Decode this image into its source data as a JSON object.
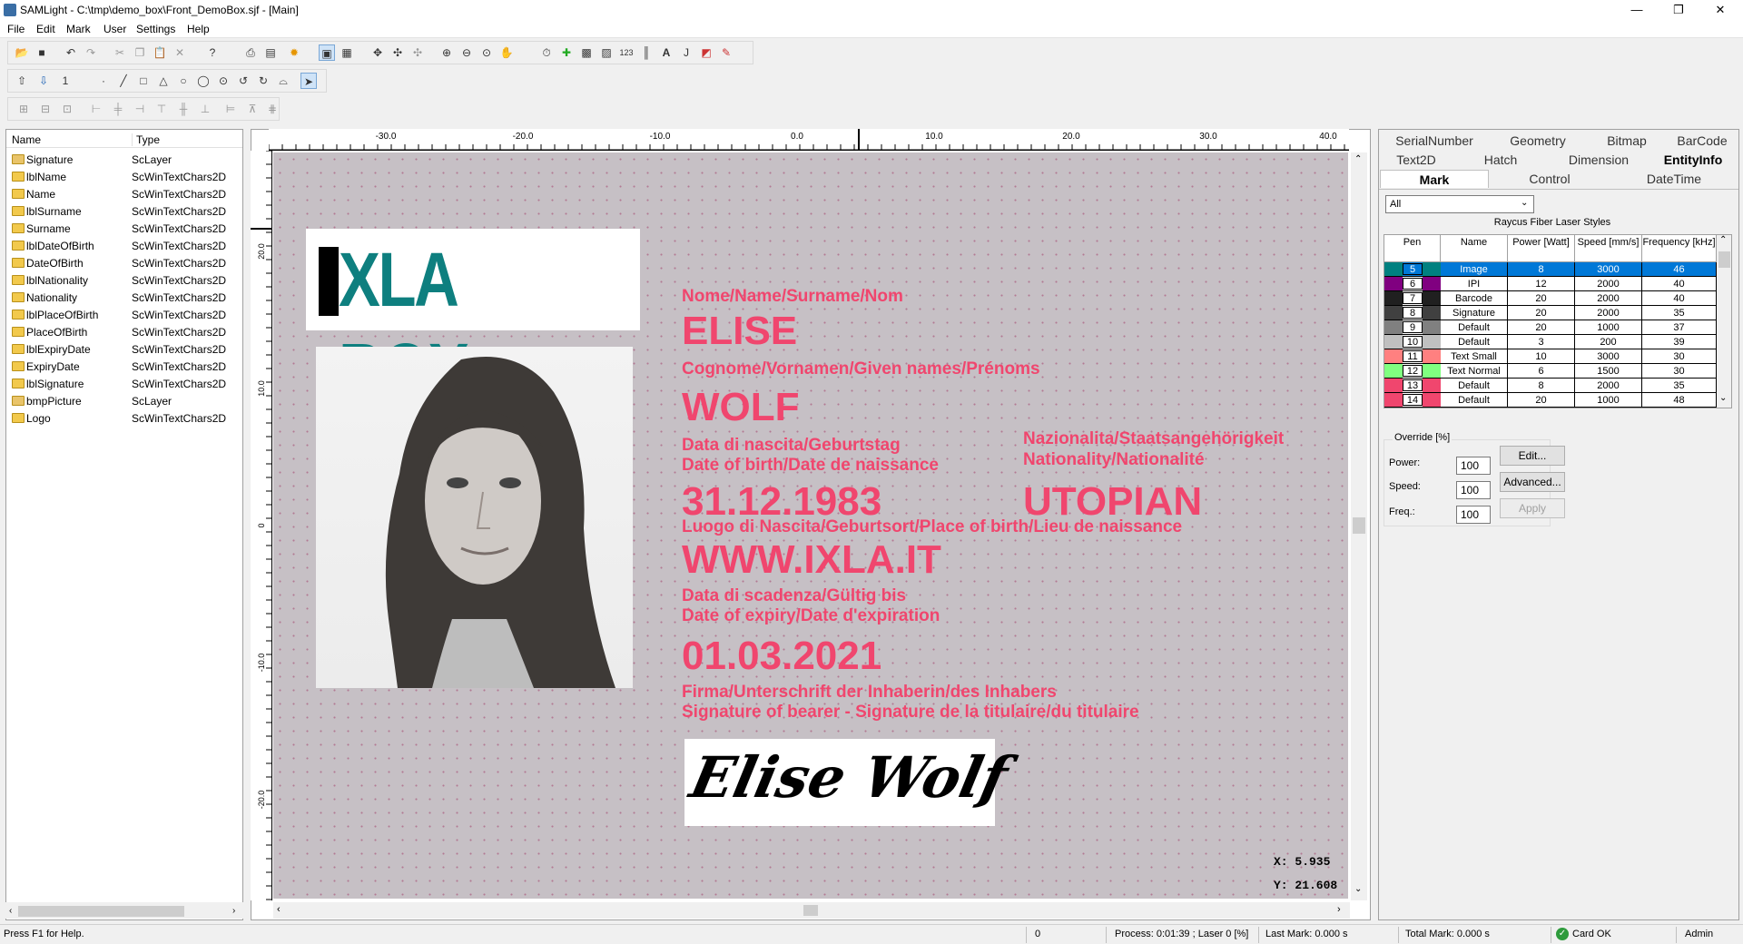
{
  "window": {
    "title": "SAMLight - C:\\tmp\\demo_box\\Front_DemoBox.sjf - [Main]",
    "minimize": "—",
    "maximize": "❐",
    "close": "✕"
  },
  "menu": [
    "File",
    "Edit",
    "Mark",
    "User",
    "Settings",
    "Help"
  ],
  "toolbar2_counter": "1",
  "tree": {
    "col_name": "Name",
    "col_type": "Type",
    "items": [
      {
        "name": "Signature",
        "type": "ScLayer",
        "kind": "layer"
      },
      {
        "name": "lblName",
        "type": "ScWinTextChars2D",
        "kind": "folder"
      },
      {
        "name": "Name",
        "type": "ScWinTextChars2D",
        "kind": "folder"
      },
      {
        "name": "lblSurname",
        "type": "ScWinTextChars2D",
        "kind": "folder"
      },
      {
        "name": "Surname",
        "type": "ScWinTextChars2D",
        "kind": "folder"
      },
      {
        "name": "lblDateOfBirth",
        "type": "ScWinTextChars2D",
        "kind": "folder"
      },
      {
        "name": "DateOfBirth",
        "type": "ScWinTextChars2D",
        "kind": "folder"
      },
      {
        "name": "lblNationality",
        "type": "ScWinTextChars2D",
        "kind": "folder"
      },
      {
        "name": "Nationality",
        "type": "ScWinTextChars2D",
        "kind": "folder"
      },
      {
        "name": "lblPlaceOfBirth",
        "type": "ScWinTextChars2D",
        "kind": "folder"
      },
      {
        "name": "PlaceOfBirth",
        "type": "ScWinTextChars2D",
        "kind": "folder"
      },
      {
        "name": "lblExpiryDate",
        "type": "ScWinTextChars2D",
        "kind": "folder"
      },
      {
        "name": "ExpiryDate",
        "type": "ScWinTextChars2D",
        "kind": "folder"
      },
      {
        "name": "lblSignature",
        "type": "ScWinTextChars2D",
        "kind": "folder"
      },
      {
        "name": "bmpPicture",
        "type": "ScLayer",
        "kind": "layer"
      },
      {
        "name": "Logo",
        "type": "ScWinTextChars2D",
        "kind": "folder"
      }
    ]
  },
  "ruler": {
    "top": [
      "-30.0",
      "-20.0",
      "-10.0",
      "0.0",
      "10.0",
      "20.0",
      "30.0",
      "40.0"
    ],
    "left": [
      "20.0",
      "10.0",
      "0",
      "-10.0",
      "-20.0"
    ]
  },
  "card": {
    "logo": "XLA BOX",
    "lbl_name": "Nome/Name/Surname/Nom",
    "name": "ELISE",
    "lbl_surname": "Cognome/Vornamen/Given names/Prénoms",
    "surname": "WOLF",
    "lbl_dob1": "Data di nascita/Geburtstag",
    "lbl_dob2": "Date of birth/Date de naissance",
    "dob": "31.12.1983",
    "lbl_nat1": "Nazionalita/Staatsangehörigkeit",
    "lbl_nat2": "Nationality/Nationalité",
    "nationality": "UTOPIAN",
    "lbl_pob": "Luogo di Nascita/Geburtsort/Place of birth/Lieu de naissance",
    "pob": "WWW.IXLA.IT",
    "lbl_exp1": "Data di scadenza/Gültig bis",
    "lbl_exp2": "Date of expiry/Date d'expiration",
    "expiry": "01.03.2021",
    "lbl_sig1": "Firma/Unterschrift der Inhaberin/des Inhabers",
    "lbl_sig2": "Signature of bearer - Signature de la titulaire/du titulaire",
    "signature": "Elise Wolf"
  },
  "coords": {
    "x": "X:  5.935",
    "y": "Y:  21.608"
  },
  "tabs": {
    "row1": [
      "SerialNumber",
      "Geometry",
      "Bitmap",
      "BarCode"
    ],
    "row2": [
      "Text2D",
      "Hatch",
      "Dimension",
      "EntityInfo"
    ],
    "row3": [
      "Mark",
      "Control",
      "DateTime"
    ]
  },
  "filter": "All",
  "styles_title": "Raycus Fiber Laser Styles",
  "pen_headers": [
    "Pen",
    "Name",
    "Power [Watt]",
    "Speed [mm/s]",
    "Frequency [kHz]"
  ],
  "pens": [
    {
      "pen": "5",
      "name": "Image",
      "power": "8",
      "speed": "3000",
      "freq": "46",
      "color": "#008080",
      "sel": true
    },
    {
      "pen": "6",
      "name": "IPI",
      "power": "12",
      "speed": "2000",
      "freq": "40",
      "color": "#800080"
    },
    {
      "pen": "7",
      "name": "Barcode",
      "power": "20",
      "speed": "2000",
      "freq": "40",
      "color": "#202020"
    },
    {
      "pen": "8",
      "name": "Signature",
      "power": "20",
      "speed": "2000",
      "freq": "35",
      "color": "#404040"
    },
    {
      "pen": "9",
      "name": "Default",
      "power": "20",
      "speed": "1000",
      "freq": "37",
      "color": "#808080"
    },
    {
      "pen": "10",
      "name": "Default",
      "power": "3",
      "speed": "200",
      "freq": "39",
      "color": "#c0c0c0"
    },
    {
      "pen": "11",
      "name": "Text Small",
      "power": "10",
      "speed": "3000",
      "freq": "30",
      "color": "#ff8080"
    },
    {
      "pen": "12",
      "name": "Text Normal",
      "power": "6",
      "speed": "1500",
      "freq": "30",
      "color": "#80ff80"
    },
    {
      "pen": "13",
      "name": "Default",
      "power": "8",
      "speed": "2000",
      "freq": "35",
      "color": "#f0466e"
    },
    {
      "pen": "14",
      "name": "Default",
      "power": "20",
      "speed": "1000",
      "freq": "48",
      "color": "#f0466e"
    }
  ],
  "override": {
    "title": "Override [%]",
    "power_label": "Power:",
    "speed_label": "Speed:",
    "freq_label": "Freq.:",
    "power": "100",
    "speed": "100",
    "freq": "100",
    "edit": "Edit...",
    "advanced": "Advanced...",
    "apply": "Apply"
  },
  "status": {
    "help": "Press F1 for Help.",
    "zero": "0",
    "process": "Process: 0:01:39 ; Laser  0 [%]",
    "last_mark": "Last Mark: 0.000 s",
    "total_mark": "Total Mark: 0.000 s",
    "card": "Card OK",
    "user": "Admin"
  }
}
